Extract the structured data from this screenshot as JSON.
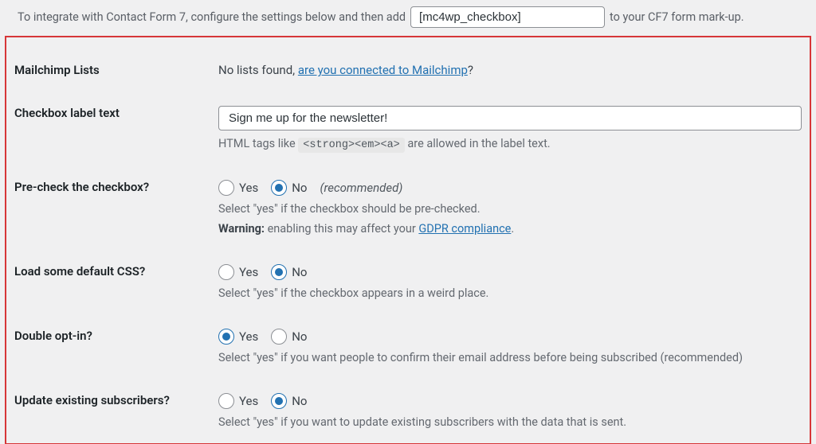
{
  "intro": {
    "before": "To integrate with Contact Form 7, configure the settings below and then add",
    "code_value": "[mc4wp_checkbox]",
    "after": "to your CF7 form mark-up."
  },
  "rows": {
    "lists": {
      "label": "Mailchimp Lists",
      "text_before_link": "No lists found, ",
      "link": "are you connected to Mailchimp",
      "text_after_link": "?"
    },
    "checkbox_label": {
      "label": "Checkbox label text",
      "value": "Sign me up for the newsletter!",
      "hint_before": "HTML tags like ",
      "hint_code": "<strong><em><a>",
      "hint_after": " are allowed in the label text."
    },
    "precheck": {
      "label": "Pre-check the checkbox?",
      "yes": "Yes",
      "no": "No",
      "recommended": "(recommended)",
      "desc1": "Select \"yes\" if the checkbox should be pre-checked.",
      "warn_label": "Warning:",
      "warn_text": " enabling this may affect your ",
      "warn_link": "GDPR compliance",
      "warn_after": "."
    },
    "css": {
      "label": "Load some default CSS?",
      "yes": "Yes",
      "no": "No",
      "desc": "Select \"yes\" if the checkbox appears in a weird place."
    },
    "double": {
      "label": "Double opt-in?",
      "yes": "Yes",
      "no": "No",
      "desc": "Select \"yes\" if you want people to confirm their email address before being subscribed (recommended)"
    },
    "update": {
      "label": "Update existing subscribers?",
      "yes": "Yes",
      "no": "No",
      "desc": "Select \"yes\" if you want to update existing subscribers with the data that is sent."
    }
  }
}
